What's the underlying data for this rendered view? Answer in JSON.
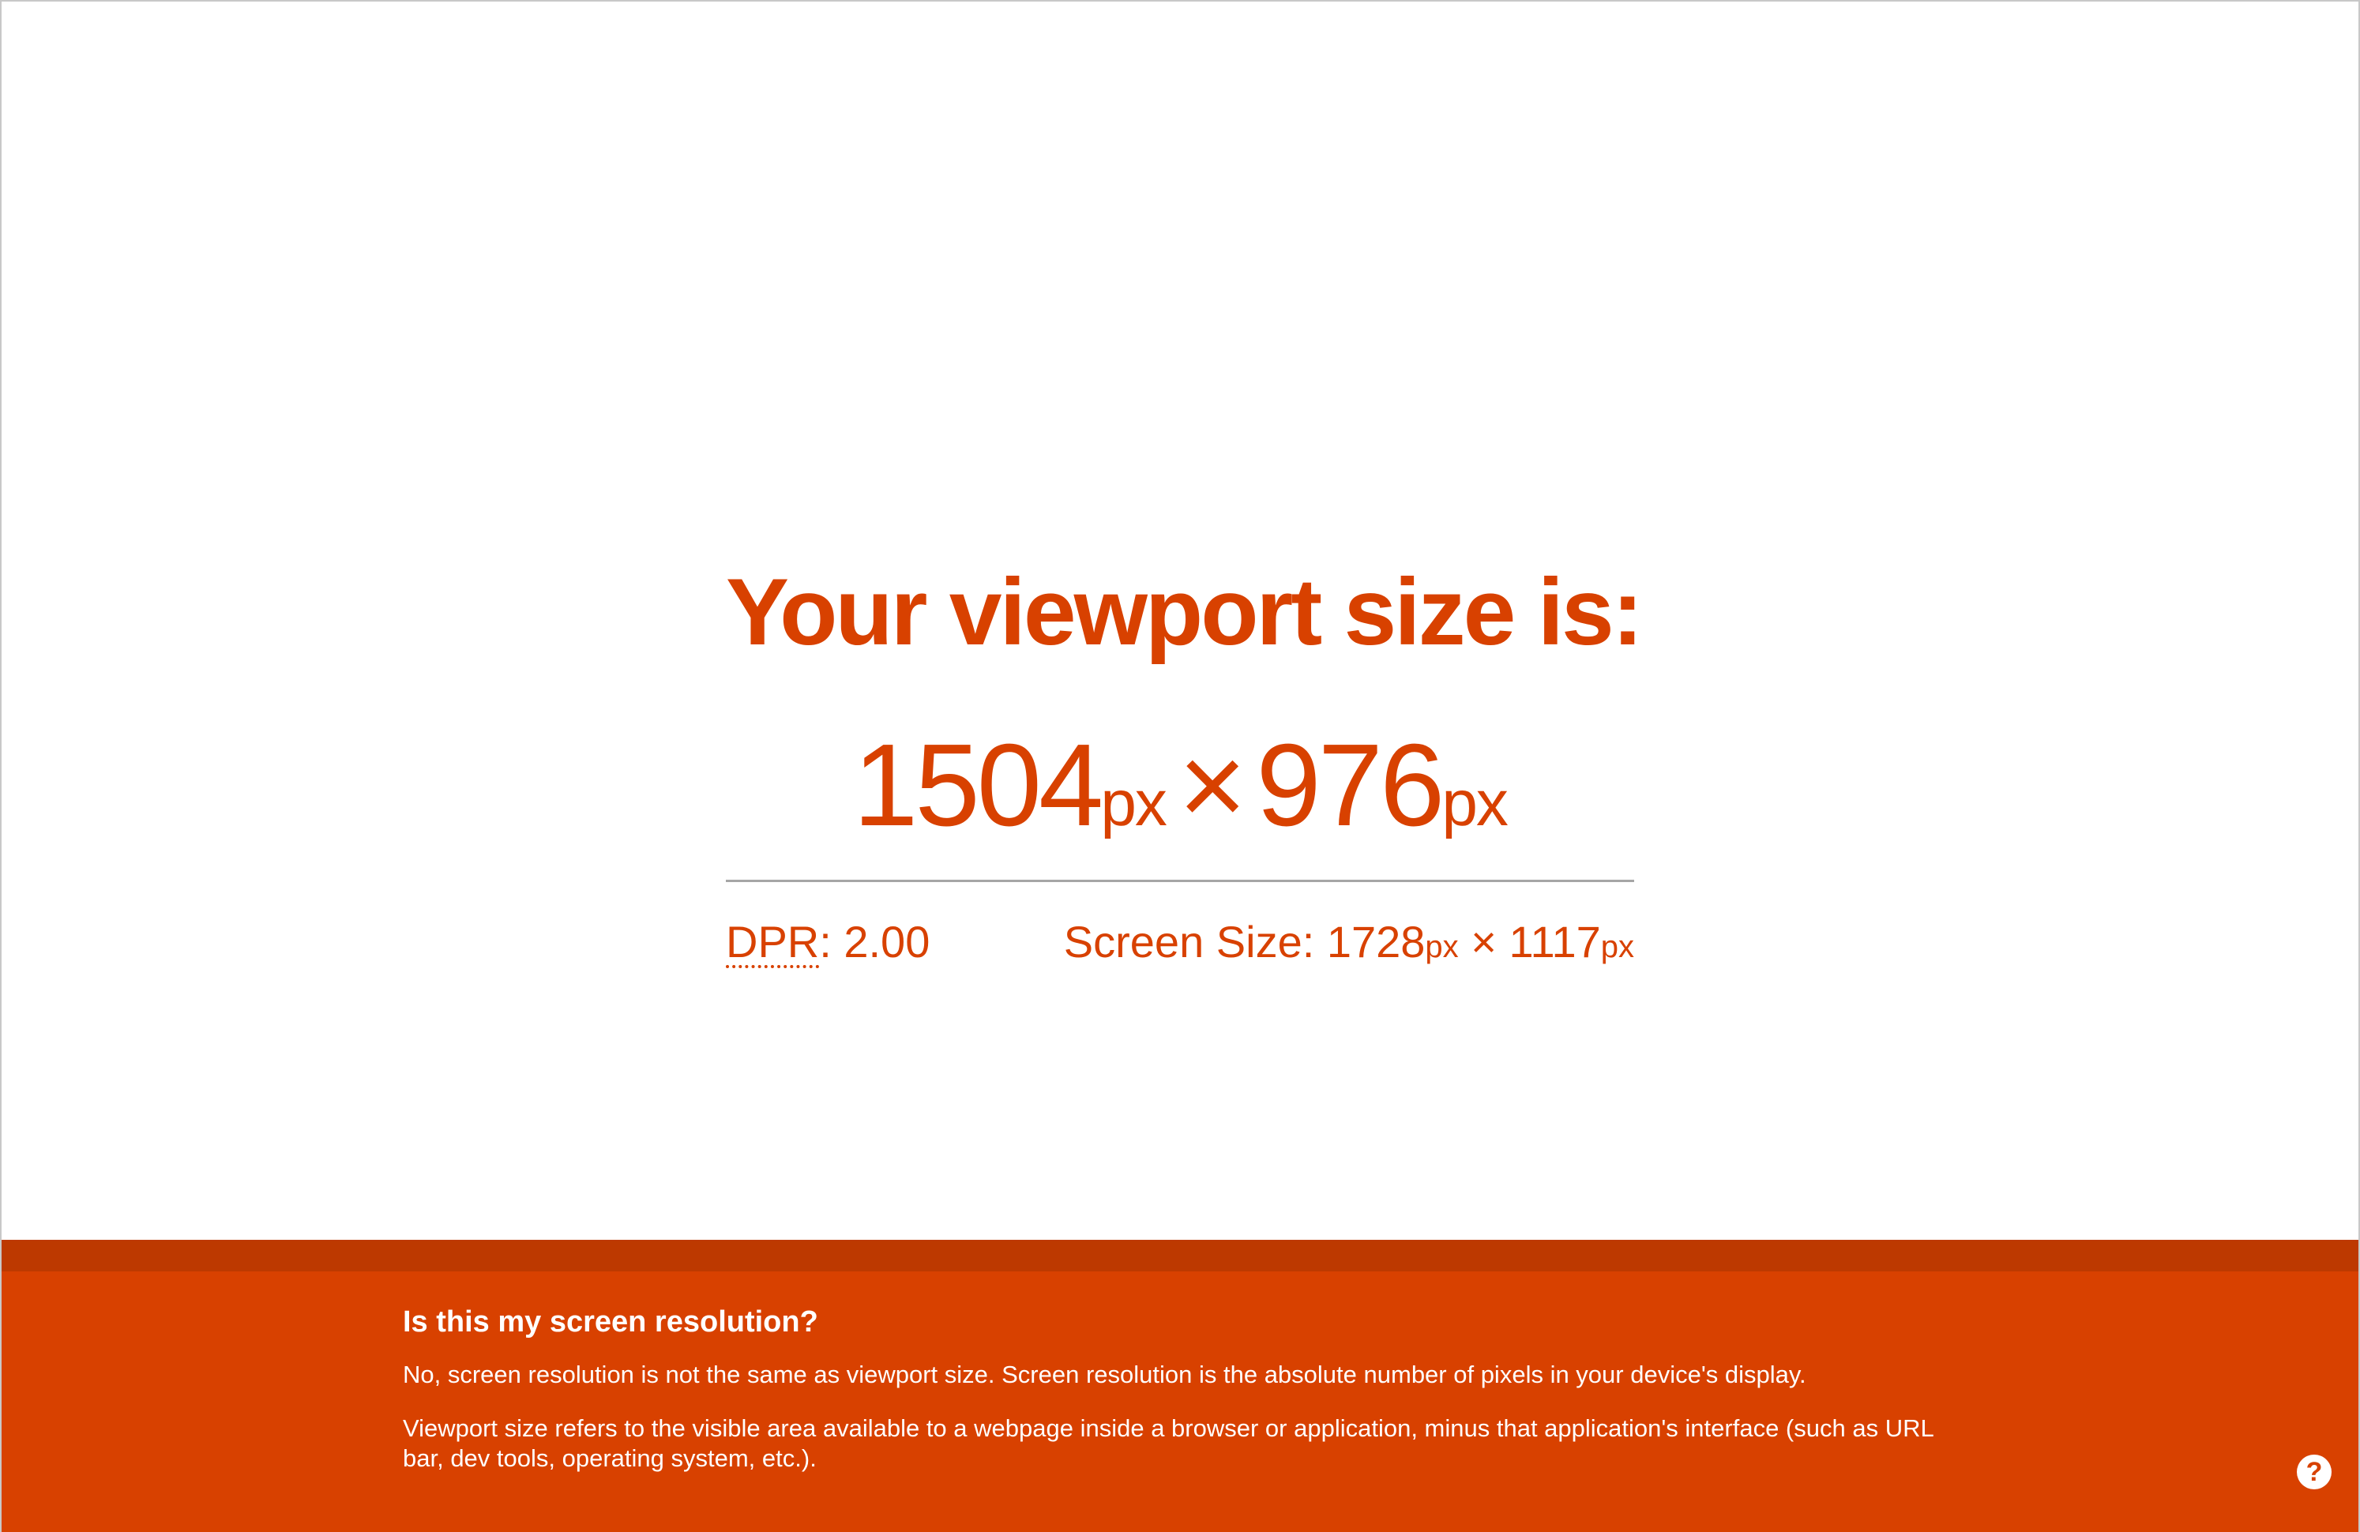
{
  "viewport": {
    "heading": "Your viewport size is:",
    "width": "1504",
    "height": "976",
    "unit": "px",
    "separator": "×"
  },
  "stats": {
    "dpr_label": "DPR",
    "dpr_value": ": 2.00",
    "screen_label": "Screen Size: ",
    "screen_width": "1728",
    "screen_height": "1117",
    "unit": "px",
    "separator": "×"
  },
  "footer": {
    "heading": "Is this my screen resolution?",
    "paragraph1": "No, screen resolution is not the same as viewport size. Screen resolution is the absolute number of pixels in your device's display.",
    "paragraph2": "Viewport size refers to the visible area available to a webpage inside a browser or application, minus that application's interface (such as URL bar, dev tools, operating system, etc.).",
    "help_icon": "?"
  },
  "colors": {
    "accent": "#d84100",
    "accent_dark": "#bd3900",
    "background": "#ffffff",
    "divider": "#a6a6a6"
  }
}
